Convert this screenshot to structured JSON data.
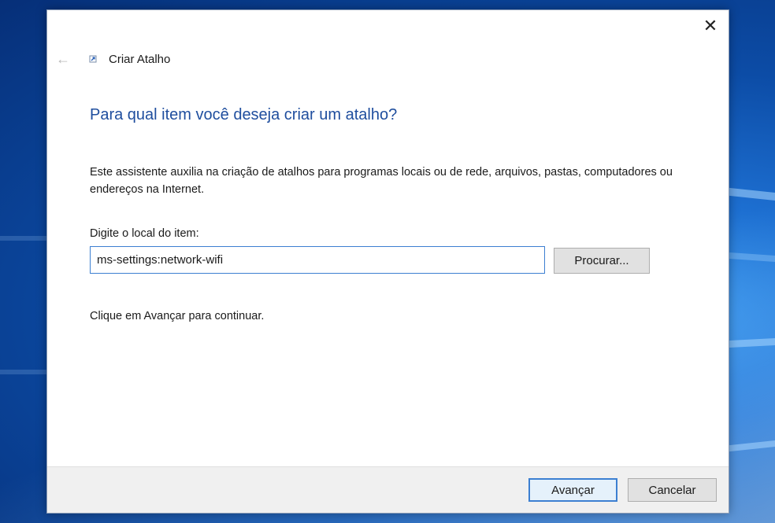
{
  "window": {
    "title": "Criar Atalho",
    "close_glyph": "✕"
  },
  "nav": {
    "back_glyph": "←",
    "shortcut_icon": "shortcut-icon"
  },
  "content": {
    "heading": "Para qual item você deseja criar um atalho?",
    "description": "Este assistente auxilia na criação de atalhos para programas locais ou de rede, arquivos, pastas, computadores ou endereços na Internet.",
    "field_label": "Digite o local do item:",
    "location_value": "ms-settings:network-wifi",
    "browse_label": "Procurar...",
    "continue_hint": "Clique em Avançar para continuar."
  },
  "footer": {
    "next_label": "Avançar",
    "cancel_label": "Cancelar"
  },
  "colors": {
    "heading": "#1f4e9e",
    "focus_border": "#3c7fd1",
    "footer_bg": "#f0f0f0",
    "button_bg": "#e1e1e1"
  }
}
